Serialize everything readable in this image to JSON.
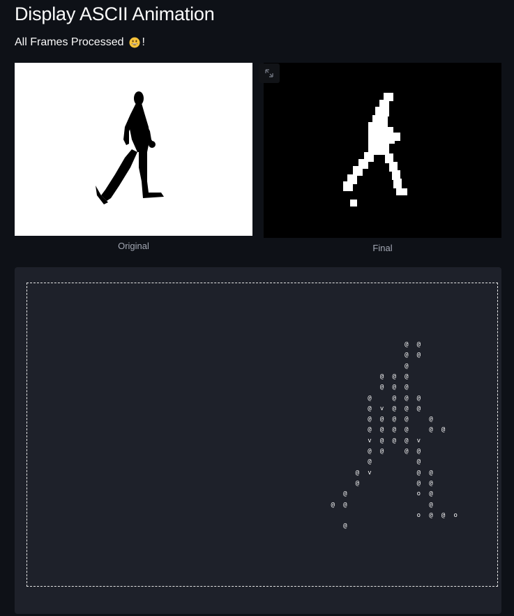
{
  "header": {
    "title": "Display ASCII Animation",
    "status_text": "All Frames Processed",
    "status_suffix": "!",
    "status_icon": "grinning-face-emoji"
  },
  "images": {
    "original": {
      "caption": "Original",
      "background": "#ffffff",
      "content": "black walking person silhouette"
    },
    "final": {
      "caption": "Final",
      "background": "#000000",
      "content": "pixelated white walking figure",
      "expand_icon": "fullscreen-expand-icon"
    }
  },
  "ascii_art": {
    "border_style": "dashed",
    "background": "#1e212a",
    "chars": [
      {
        "c": "@",
        "col": 19,
        "row": 0
      },
      {
        "c": "@",
        "col": 20,
        "row": 0
      },
      {
        "c": "@",
        "col": 19,
        "row": 1
      },
      {
        "c": "@",
        "col": 20,
        "row": 1
      },
      {
        "c": "@",
        "col": 19,
        "row": 2
      },
      {
        "c": "@",
        "col": 17,
        "row": 3
      },
      {
        "c": "@",
        "col": 18,
        "row": 3
      },
      {
        "c": "@",
        "col": 19,
        "row": 3
      },
      {
        "c": "@",
        "col": 17,
        "row": 4
      },
      {
        "c": "@",
        "col": 18,
        "row": 4
      },
      {
        "c": "@",
        "col": 19,
        "row": 4
      },
      {
        "c": "@",
        "col": 16,
        "row": 5
      },
      {
        "c": "@",
        "col": 18,
        "row": 5
      },
      {
        "c": "@",
        "col": 19,
        "row": 5
      },
      {
        "c": "@",
        "col": 20,
        "row": 5
      },
      {
        "c": "@",
        "col": 16,
        "row": 6
      },
      {
        "c": "v",
        "col": 17,
        "row": 6
      },
      {
        "c": "@",
        "col": 18,
        "row": 6
      },
      {
        "c": "@",
        "col": 19,
        "row": 6
      },
      {
        "c": "@",
        "col": 20,
        "row": 6
      },
      {
        "c": "@",
        "col": 16,
        "row": 7
      },
      {
        "c": "@",
        "col": 17,
        "row": 7
      },
      {
        "c": "@",
        "col": 18,
        "row": 7
      },
      {
        "c": "@",
        "col": 19,
        "row": 7
      },
      {
        "c": "@",
        "col": 21,
        "row": 7
      },
      {
        "c": "@",
        "col": 16,
        "row": 8
      },
      {
        "c": "@",
        "col": 17,
        "row": 8
      },
      {
        "c": "@",
        "col": 18,
        "row": 8
      },
      {
        "c": "@",
        "col": 19,
        "row": 8
      },
      {
        "c": "@",
        "col": 21,
        "row": 8
      },
      {
        "c": "@",
        "col": 22,
        "row": 8
      },
      {
        "c": "v",
        "col": 16,
        "row": 9
      },
      {
        "c": "@",
        "col": 17,
        "row": 9
      },
      {
        "c": "@",
        "col": 18,
        "row": 9
      },
      {
        "c": "@",
        "col": 19,
        "row": 9
      },
      {
        "c": "v",
        "col": 20,
        "row": 9
      },
      {
        "c": "@",
        "col": 16,
        "row": 10
      },
      {
        "c": "@",
        "col": 17,
        "row": 10
      },
      {
        "c": "@",
        "col": 19,
        "row": 10
      },
      {
        "c": "@",
        "col": 20,
        "row": 10
      },
      {
        "c": "@",
        "col": 16,
        "row": 11
      },
      {
        "c": "@",
        "col": 20,
        "row": 11
      },
      {
        "c": "@",
        "col": 15,
        "row": 12
      },
      {
        "c": "v",
        "col": 16,
        "row": 12
      },
      {
        "c": "@",
        "col": 20,
        "row": 12
      },
      {
        "c": "@",
        "col": 21,
        "row": 12
      },
      {
        "c": "@",
        "col": 15,
        "row": 13
      },
      {
        "c": "@",
        "col": 20,
        "row": 13
      },
      {
        "c": "@",
        "col": 21,
        "row": 13
      },
      {
        "c": "@",
        "col": 14,
        "row": 14
      },
      {
        "c": "o",
        "col": 20,
        "row": 14
      },
      {
        "c": "@",
        "col": 21,
        "row": 14
      },
      {
        "c": "@",
        "col": 13,
        "row": 15
      },
      {
        "c": "@",
        "col": 14,
        "row": 15
      },
      {
        "c": "@",
        "col": 21,
        "row": 15
      },
      {
        "c": "o",
        "col": 20,
        "row": 16
      },
      {
        "c": "@",
        "col": 21,
        "row": 16
      },
      {
        "c": "@",
        "col": 22,
        "row": 16
      },
      {
        "c": "o",
        "col": 23,
        "row": 16
      },
      {
        "c": "@",
        "col": 14,
        "row": 17
      }
    ]
  }
}
